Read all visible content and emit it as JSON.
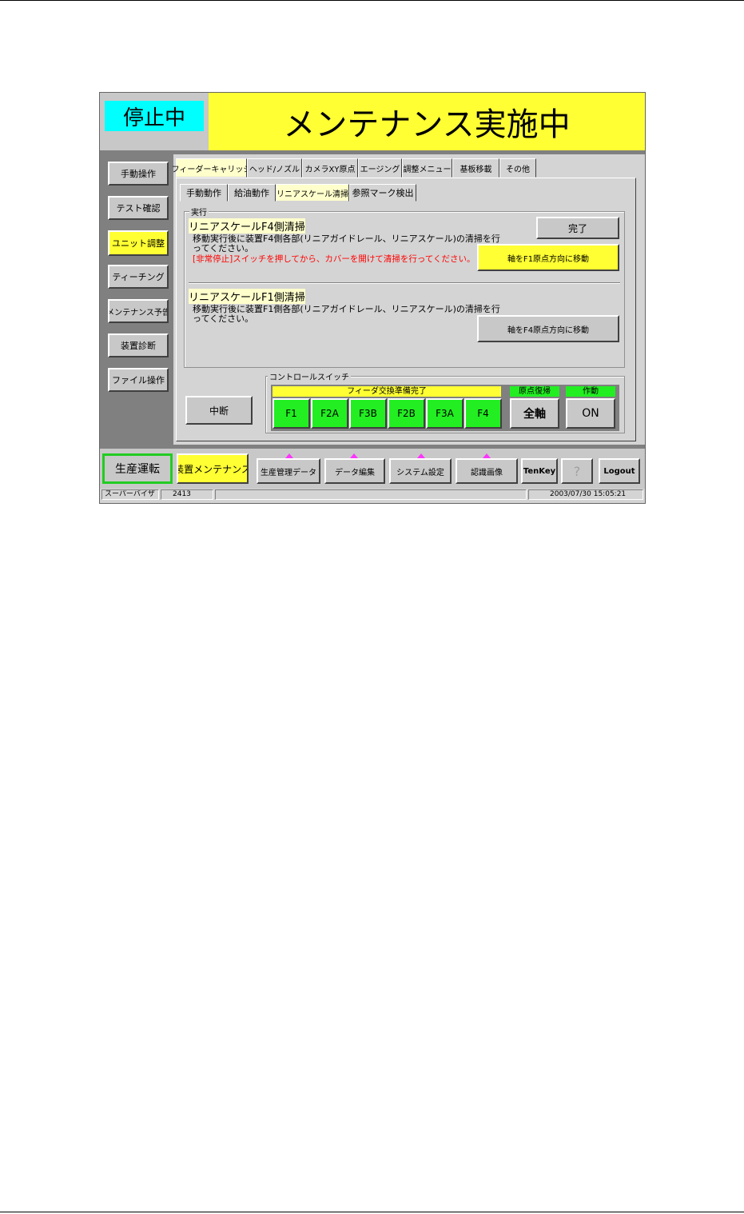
{
  "header": {
    "status_label": "停止中",
    "banner_title": "メンテナンス実施中"
  },
  "sidebar": {
    "items": [
      {
        "label": "手動操作"
      },
      {
        "label": "テスト確認"
      },
      {
        "label": "ユニット調整"
      },
      {
        "label": "ティーチング"
      },
      {
        "label": "メンテナンス予告"
      },
      {
        "label": "装置診断"
      },
      {
        "label": "ファイル操作"
      }
    ],
    "active_index": 2
  },
  "main_tabs": [
    {
      "label": "フィーダーキャリッジ"
    },
    {
      "label": "ヘッド/ノズル"
    },
    {
      "label": "カメラXY原点"
    },
    {
      "label": "エージング"
    },
    {
      "label": "調整メニュー"
    },
    {
      "label": "基板移載"
    },
    {
      "label": "その他"
    }
  ],
  "sub_tabs": [
    {
      "label": "手動動作"
    },
    {
      "label": "給油動作"
    },
    {
      "label": "リニアスケール清掃"
    },
    {
      "label": "参照マーク検出"
    }
  ],
  "execute_group": {
    "legend": "実行",
    "f4_section": {
      "title": "リニアスケールF4側清掃",
      "desc_line1": "移動実行後に装置F4側各部(リニアガイドレール、リニアスケール)の清掃を行",
      "desc_line2": "ってください。",
      "warning": "[非常停止]スイッチを押してから、カバーを開けて清掃を行ってください。",
      "done_button": "完了",
      "move_button": "軸をF1原点方向に移動"
    },
    "f1_section": {
      "title": "リニアスケールF1側清掃",
      "desc_line1": "移動実行後に装置F1側各部(リニアガイドレール、リニアスケール)の清掃を行",
      "desc_line2": "ってください。",
      "move_button": "軸をF4原点方向に移動"
    }
  },
  "abort_button": "中断",
  "control_switch": {
    "legend": "コントロールスイッチ",
    "feeder_header": "フィーダ交換準備完了",
    "feeders": [
      "F1",
      "F2A",
      "F3B",
      "F2B",
      "F3A",
      "F4"
    ],
    "origin_header": "原点復帰",
    "origin_button": "全軸",
    "operation_header": "作動",
    "operation_button": "ON"
  },
  "bottom_bar": {
    "production_button": "生産運転",
    "maintenance_button": "装置メンテナンス",
    "nav_buttons": [
      "生産管理データ",
      "データ編集",
      "システム設定",
      "認識画像"
    ],
    "tenkey_button": "TenKey",
    "help_button": "?",
    "logout_button": "Logout"
  },
  "status_bar": {
    "user": "スーパーバイザ",
    "code": "2413",
    "message": "",
    "datetime": "2003/07/30 15:05:21"
  },
  "colors": {
    "screen_bg": "#808080",
    "panel_bg": "#d4d4d4",
    "banner_yellow": "#ffff33",
    "status_cyan": "#00ffff",
    "feeder_green": "#22ee22",
    "warning_red": "#ff0000",
    "marker_magenta": "#ff33ff"
  }
}
